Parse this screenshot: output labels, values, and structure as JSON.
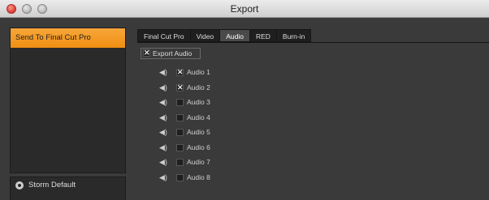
{
  "window": {
    "title": "Export"
  },
  "sidebar": {
    "items": [
      {
        "label": "Send To Final Cut Pro"
      }
    ]
  },
  "preset": {
    "label": "Storm Default"
  },
  "tabs": [
    {
      "label": "Final Cut Pro"
    },
    {
      "label": "Video"
    },
    {
      "label": "Audio"
    },
    {
      "label": "RED"
    },
    {
      "label": "Burn-in"
    }
  ],
  "active_tab": "Audio",
  "audio": {
    "export_audio": {
      "label": "Export Audio",
      "checked": true
    },
    "tracks": [
      {
        "label": "Audio 1",
        "checked": true
      },
      {
        "label": "Audio 2",
        "checked": true
      },
      {
        "label": "Audio 3",
        "checked": false
      },
      {
        "label": "Audio 4",
        "checked": false
      },
      {
        "label": "Audio 5",
        "checked": false
      },
      {
        "label": "Audio 6",
        "checked": false
      },
      {
        "label": "Audio 7",
        "checked": false
      },
      {
        "label": "Audio 8",
        "checked": false
      }
    ]
  },
  "colors": {
    "accent": "#f29a1f",
    "window_bg": "#3a3a3a",
    "panel_bg": "#2a2a2a"
  },
  "icons": {
    "track": "speaker-icon",
    "preset": "gear-icon"
  }
}
